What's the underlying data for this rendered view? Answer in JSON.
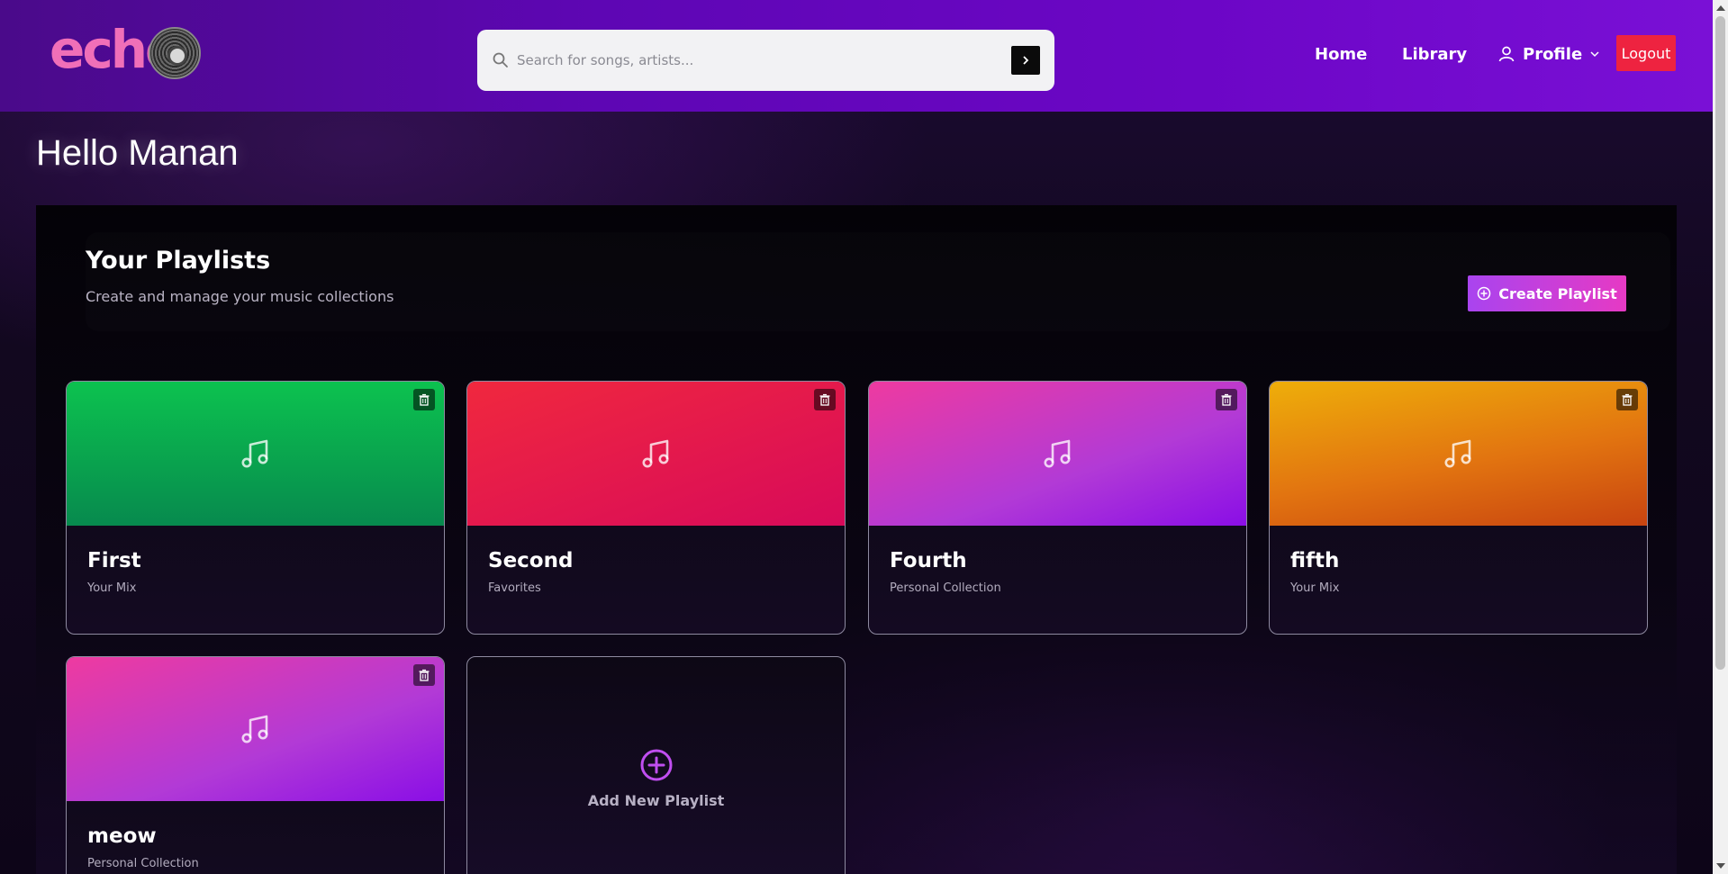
{
  "header": {
    "logo_text": "echo",
    "search": {
      "placeholder": "Search for songs, artists..."
    },
    "nav": {
      "home": "Home",
      "library": "Library",
      "profile": "Profile",
      "logout": "Logout"
    }
  },
  "greeting": "Hello Manan",
  "playlists_section": {
    "title": "Your Playlists",
    "subtitle": "Create and manage your music collections",
    "create_label": "Create Playlist",
    "add_new_label": "Add New Playlist",
    "playlists": [
      {
        "name": "First",
        "type": "Your Mix",
        "color": "#0cc24f"
      },
      {
        "name": "Second",
        "type": "Favorites",
        "color": "#ef2244"
      },
      {
        "name": "Fourth",
        "type": "Personal Collection",
        "color": "#c83ac8"
      },
      {
        "name": "fifth",
        "type": "Your Mix",
        "color": "#e88a0c"
      },
      {
        "name": "meow",
        "type": "Personal Collection",
        "color": "#c83ac8"
      }
    ]
  },
  "colors": {
    "header_bg": "#5e06b4",
    "accent_pink": "#f06fb8",
    "logout_bg": "#ee2340",
    "create_button_start": "#a944ef",
    "create_button_end": "#e63ac4"
  }
}
